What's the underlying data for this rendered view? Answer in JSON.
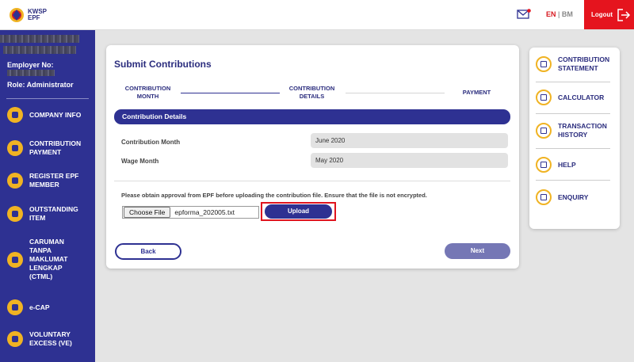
{
  "header": {
    "logo_line1": "KWSP",
    "logo_line2": "EPF",
    "lang_en": "EN",
    "lang_sep": "|",
    "lang_bm": "BM",
    "logout_label": "Logout"
  },
  "sidebar": {
    "employer_label": "Employer No:",
    "role_label": "Role: Administrator",
    "items": [
      {
        "label": "COMPANY INFO",
        "icon": "building-icon"
      },
      {
        "label": "CONTRIBUTION\nPAYMENT",
        "icon": "coins-icon"
      },
      {
        "label": "REGISTER EPF\nMEMBER",
        "icon": "member-icon"
      },
      {
        "label": "OUTSTANDING\nITEM",
        "icon": "briefcase-icon"
      },
      {
        "label": "CARUMAN\nTANPA\nMAKLUMAT\nLENGKAP\n(CTML)",
        "icon": "document-icon"
      },
      {
        "label": "e-CAP",
        "icon": "cap-icon"
      },
      {
        "label": "VOLUNTARY\nEXCESS (VE)",
        "icon": "calendar-icon"
      }
    ]
  },
  "main": {
    "title": "Submit Contributions",
    "steps": [
      {
        "label": "CONTRIBUTION\nMONTH"
      },
      {
        "label": "CONTRIBUTION\nDETAILS"
      },
      {
        "label": "PAYMENT"
      }
    ],
    "section_title": "Contribution Details",
    "fields": [
      {
        "label": "Contribution Month",
        "value": "June 2020"
      },
      {
        "label": "Wage Month",
        "value": "May 2020"
      }
    ],
    "notice": "Please obtain approval from EPF before uploading the contribution file. Ensure that the file is not encrypted.",
    "choose_file_label": "Choose File",
    "file_name": "epforma_202005.txt",
    "upload_label": "Upload",
    "back_label": "Back",
    "next_label": "Next"
  },
  "right_panel": {
    "items": [
      {
        "label": "CONTRIBUTION\nSTATEMENT",
        "icon": "statement-icon"
      },
      {
        "label": "CALCULATOR",
        "icon": "calculator-icon"
      },
      {
        "label": "TRANSACTION\nHISTORY",
        "icon": "history-icon"
      },
      {
        "label": "HELP",
        "icon": "help-icon"
      },
      {
        "label": "ENQUIRY",
        "icon": "enquiry-icon"
      }
    ]
  },
  "colors": {
    "brand_navy": "#2e3192",
    "accent_red": "#e5141e",
    "accent_gold": "#f0b323"
  }
}
